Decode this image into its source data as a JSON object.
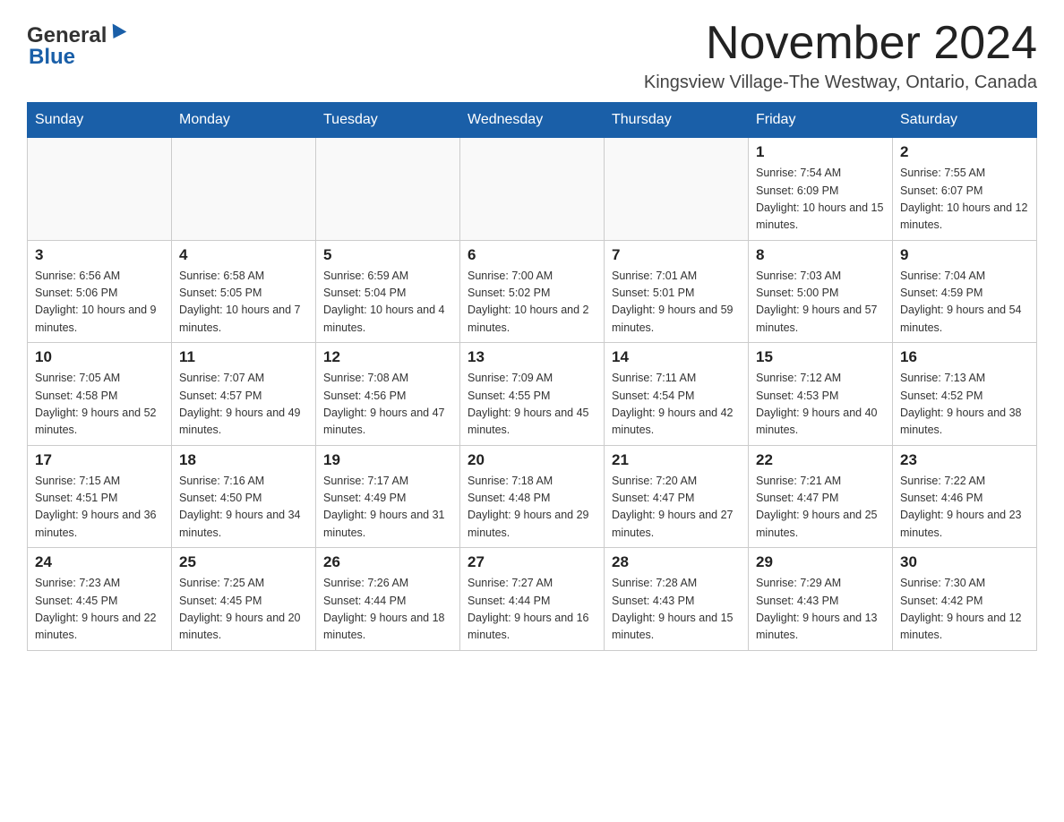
{
  "header": {
    "logo_general": "General",
    "logo_blue": "Blue",
    "title": "November 2024",
    "subtitle": "Kingsview Village-The Westway, Ontario, Canada"
  },
  "weekdays": [
    "Sunday",
    "Monday",
    "Tuesday",
    "Wednesday",
    "Thursday",
    "Friday",
    "Saturday"
  ],
  "weeks": [
    [
      {
        "day": "",
        "sunrise": "",
        "sunset": "",
        "daylight": ""
      },
      {
        "day": "",
        "sunrise": "",
        "sunset": "",
        "daylight": ""
      },
      {
        "day": "",
        "sunrise": "",
        "sunset": "",
        "daylight": ""
      },
      {
        "day": "",
        "sunrise": "",
        "sunset": "",
        "daylight": ""
      },
      {
        "day": "",
        "sunrise": "",
        "sunset": "",
        "daylight": ""
      },
      {
        "day": "1",
        "sunrise": "Sunrise: 7:54 AM",
        "sunset": "Sunset: 6:09 PM",
        "daylight": "Daylight: 10 hours and 15 minutes."
      },
      {
        "day": "2",
        "sunrise": "Sunrise: 7:55 AM",
        "sunset": "Sunset: 6:07 PM",
        "daylight": "Daylight: 10 hours and 12 minutes."
      }
    ],
    [
      {
        "day": "3",
        "sunrise": "Sunrise: 6:56 AM",
        "sunset": "Sunset: 5:06 PM",
        "daylight": "Daylight: 10 hours and 9 minutes."
      },
      {
        "day": "4",
        "sunrise": "Sunrise: 6:58 AM",
        "sunset": "Sunset: 5:05 PM",
        "daylight": "Daylight: 10 hours and 7 minutes."
      },
      {
        "day": "5",
        "sunrise": "Sunrise: 6:59 AM",
        "sunset": "Sunset: 5:04 PM",
        "daylight": "Daylight: 10 hours and 4 minutes."
      },
      {
        "day": "6",
        "sunrise": "Sunrise: 7:00 AM",
        "sunset": "Sunset: 5:02 PM",
        "daylight": "Daylight: 10 hours and 2 minutes."
      },
      {
        "day": "7",
        "sunrise": "Sunrise: 7:01 AM",
        "sunset": "Sunset: 5:01 PM",
        "daylight": "Daylight: 9 hours and 59 minutes."
      },
      {
        "day": "8",
        "sunrise": "Sunrise: 7:03 AM",
        "sunset": "Sunset: 5:00 PM",
        "daylight": "Daylight: 9 hours and 57 minutes."
      },
      {
        "day": "9",
        "sunrise": "Sunrise: 7:04 AM",
        "sunset": "Sunset: 4:59 PM",
        "daylight": "Daylight: 9 hours and 54 minutes."
      }
    ],
    [
      {
        "day": "10",
        "sunrise": "Sunrise: 7:05 AM",
        "sunset": "Sunset: 4:58 PM",
        "daylight": "Daylight: 9 hours and 52 minutes."
      },
      {
        "day": "11",
        "sunrise": "Sunrise: 7:07 AM",
        "sunset": "Sunset: 4:57 PM",
        "daylight": "Daylight: 9 hours and 49 minutes."
      },
      {
        "day": "12",
        "sunrise": "Sunrise: 7:08 AM",
        "sunset": "Sunset: 4:56 PM",
        "daylight": "Daylight: 9 hours and 47 minutes."
      },
      {
        "day": "13",
        "sunrise": "Sunrise: 7:09 AM",
        "sunset": "Sunset: 4:55 PM",
        "daylight": "Daylight: 9 hours and 45 minutes."
      },
      {
        "day": "14",
        "sunrise": "Sunrise: 7:11 AM",
        "sunset": "Sunset: 4:54 PM",
        "daylight": "Daylight: 9 hours and 42 minutes."
      },
      {
        "day": "15",
        "sunrise": "Sunrise: 7:12 AM",
        "sunset": "Sunset: 4:53 PM",
        "daylight": "Daylight: 9 hours and 40 minutes."
      },
      {
        "day": "16",
        "sunrise": "Sunrise: 7:13 AM",
        "sunset": "Sunset: 4:52 PM",
        "daylight": "Daylight: 9 hours and 38 minutes."
      }
    ],
    [
      {
        "day": "17",
        "sunrise": "Sunrise: 7:15 AM",
        "sunset": "Sunset: 4:51 PM",
        "daylight": "Daylight: 9 hours and 36 minutes."
      },
      {
        "day": "18",
        "sunrise": "Sunrise: 7:16 AM",
        "sunset": "Sunset: 4:50 PM",
        "daylight": "Daylight: 9 hours and 34 minutes."
      },
      {
        "day": "19",
        "sunrise": "Sunrise: 7:17 AM",
        "sunset": "Sunset: 4:49 PM",
        "daylight": "Daylight: 9 hours and 31 minutes."
      },
      {
        "day": "20",
        "sunrise": "Sunrise: 7:18 AM",
        "sunset": "Sunset: 4:48 PM",
        "daylight": "Daylight: 9 hours and 29 minutes."
      },
      {
        "day": "21",
        "sunrise": "Sunrise: 7:20 AM",
        "sunset": "Sunset: 4:47 PM",
        "daylight": "Daylight: 9 hours and 27 minutes."
      },
      {
        "day": "22",
        "sunrise": "Sunrise: 7:21 AM",
        "sunset": "Sunset: 4:47 PM",
        "daylight": "Daylight: 9 hours and 25 minutes."
      },
      {
        "day": "23",
        "sunrise": "Sunrise: 7:22 AM",
        "sunset": "Sunset: 4:46 PM",
        "daylight": "Daylight: 9 hours and 23 minutes."
      }
    ],
    [
      {
        "day": "24",
        "sunrise": "Sunrise: 7:23 AM",
        "sunset": "Sunset: 4:45 PM",
        "daylight": "Daylight: 9 hours and 22 minutes."
      },
      {
        "day": "25",
        "sunrise": "Sunrise: 7:25 AM",
        "sunset": "Sunset: 4:45 PM",
        "daylight": "Daylight: 9 hours and 20 minutes."
      },
      {
        "day": "26",
        "sunrise": "Sunrise: 7:26 AM",
        "sunset": "Sunset: 4:44 PM",
        "daylight": "Daylight: 9 hours and 18 minutes."
      },
      {
        "day": "27",
        "sunrise": "Sunrise: 7:27 AM",
        "sunset": "Sunset: 4:44 PM",
        "daylight": "Daylight: 9 hours and 16 minutes."
      },
      {
        "day": "28",
        "sunrise": "Sunrise: 7:28 AM",
        "sunset": "Sunset: 4:43 PM",
        "daylight": "Daylight: 9 hours and 15 minutes."
      },
      {
        "day": "29",
        "sunrise": "Sunrise: 7:29 AM",
        "sunset": "Sunset: 4:43 PM",
        "daylight": "Daylight: 9 hours and 13 minutes."
      },
      {
        "day": "30",
        "sunrise": "Sunrise: 7:30 AM",
        "sunset": "Sunset: 4:42 PM",
        "daylight": "Daylight: 9 hours and 12 minutes."
      }
    ]
  ]
}
